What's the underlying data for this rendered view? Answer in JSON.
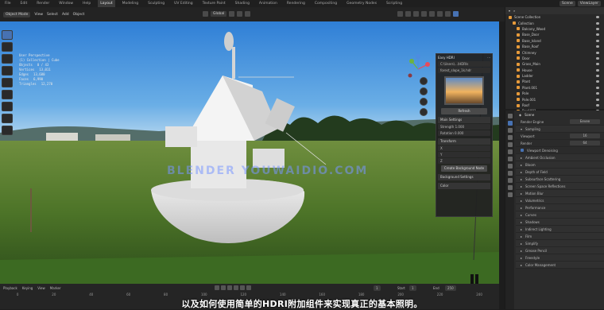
{
  "topbar": {
    "menus": [
      "File",
      "Edit",
      "Render",
      "Window",
      "Help"
    ],
    "tabs": [
      "Layout",
      "Modeling",
      "Sculpting",
      "UV Editing",
      "Texture Paint",
      "Shading",
      "Animation",
      "Rendering",
      "Compositing",
      "Geometry Nodes",
      "Scripting"
    ],
    "active_tab": "Layout",
    "scene": "Scene",
    "view_layer": "ViewLayer"
  },
  "header": {
    "mode": "Object Mode",
    "view": "View",
    "select": "Select",
    "add": "Add",
    "object": "Object",
    "transform": "Global"
  },
  "viewport_info": [
    {
      "k": "User Perspective",
      "v": ""
    },
    {
      "k": "(1) Collection | Cube",
      "v": ""
    },
    {
      "k": "Objects",
      "v": "0 / 43"
    },
    {
      "k": "Vertices",
      "v": "13,011"
    },
    {
      "k": "Edges",
      "v": "13,680"
    },
    {
      "k": "Faces",
      "v": "6,990"
    },
    {
      "k": "Triangles",
      "v": "12,270"
    }
  ],
  "hdri_panel": {
    "title": "Easy HDRI",
    "folder": "C:\\Users\\...\\HDRIs",
    "file": "forest_slope_1k.hdr",
    "preview_btn": "Refresh",
    "settings": "Main Settings",
    "strength_label": "Strength",
    "strength": "1.000",
    "rotation_label": "Rotation",
    "rotation": "0.000",
    "transform": "Transform",
    "axes": [
      "X",
      "Y",
      "Z"
    ],
    "create_btn": "Create Background Node",
    "sun_btn": "Background Settings",
    "color_btn": "Color"
  },
  "outliner": {
    "items": [
      "Scene Collection",
      "Collection",
      "Balcony_Wood",
      "Base_Door",
      "Base_Island",
      "Base_Roof",
      "Chimney",
      "Door",
      "Grass_Main",
      "House",
      "Ladder",
      "Plant",
      "Plant.001",
      "Pole",
      "Pole.001",
      "Roof",
      "Roof.001",
      "Rocks"
    ]
  },
  "properties": {
    "title": "Scene",
    "render_engine_label": "Render Engine",
    "render_engine": "Eevee",
    "sampling": "Sampling",
    "viewport_label": "Viewport",
    "viewport": "16",
    "render_label": "Render",
    "render": "64",
    "denoise": "Viewport Denoising",
    "panels": [
      "Ambient Occlusion",
      "Bloom",
      "Depth of Field",
      "Subsurface Scattering",
      "Screen Space Reflections",
      "Motion Blur",
      "Volumetrics",
      "Performance",
      "Curves",
      "Shadows",
      "Indirect Lighting",
      "Film",
      "Simplify",
      "Grease Pencil",
      "Freestyle",
      "Color Management"
    ]
  },
  "timeline": {
    "playback": "Playback",
    "keying": "Keying",
    "view": "View",
    "marker": "Marker",
    "current_frame": "1",
    "start_label": "Start",
    "start": "1",
    "end_label": "End",
    "end": "250",
    "ruler": [
      "0",
      "20",
      "40",
      "60",
      "80",
      "100",
      "120",
      "140",
      "160",
      "180",
      "200",
      "220",
      "240"
    ]
  },
  "subtitle": "以及如何使用简单的HDRI附加组件来实现真正的基本照明。",
  "watermark": "BLENDER YOUWAIDIO.COM",
  "colors": {
    "accent": "#4772b3",
    "panel": "#2b2b2b",
    "header": "#232323"
  }
}
